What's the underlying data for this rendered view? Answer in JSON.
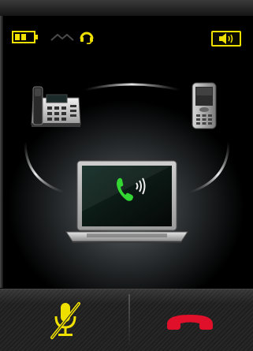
{
  "status": {
    "battery_icon": "battery-icon",
    "signal_icon": "signal-wave-icon",
    "headset_icon": "headset-icon",
    "speaker_icon": "speaker-volume-icon",
    "indicator_color": "#f0e000"
  },
  "devices": {
    "desk_phone": "desk-phone-icon",
    "mobile_phone": "mobile-phone-icon",
    "laptop": "laptop-icon",
    "active_call": "phone-handset-icon"
  },
  "controls": {
    "mute_icon": "microphone-muted-icon",
    "end_call_icon": "end-call-icon",
    "mute_color": "#f0e000",
    "end_call_color": "#e0102a"
  },
  "accent_colors": {
    "call_green": "#33d633",
    "background": "#000000"
  }
}
